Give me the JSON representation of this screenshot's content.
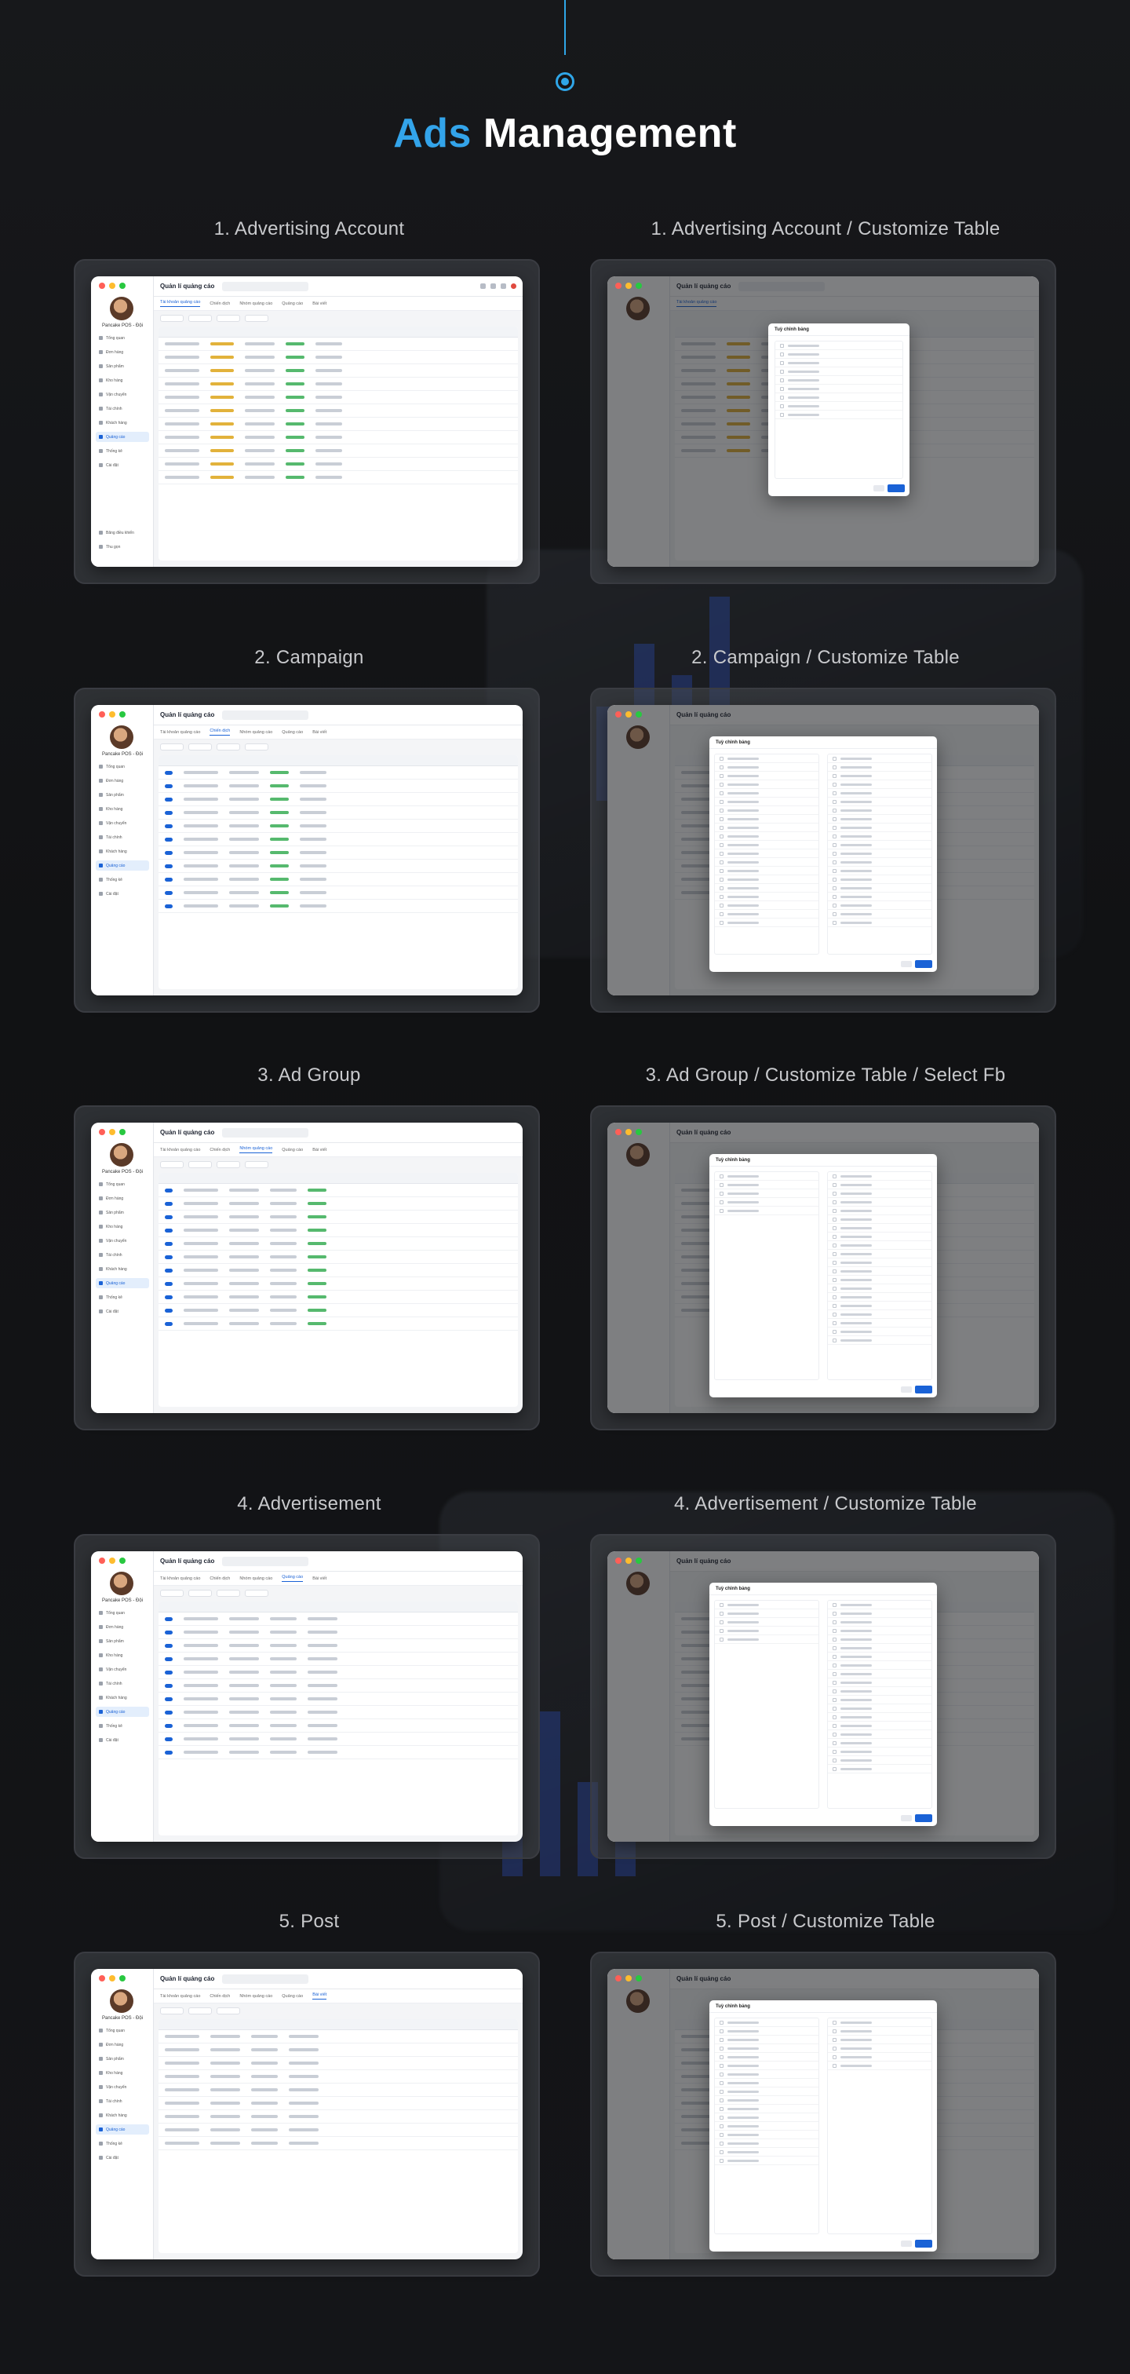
{
  "page": {
    "title_accent": "Ads",
    "title_rest": " Management"
  },
  "screens": {
    "s1": {
      "label": "1. Advertising Account",
      "window_title": "Quản lí quảng cáo"
    },
    "s2": {
      "label": "1. Advertising Account / Customize Table",
      "window_title": "Quản lí quảng cáo",
      "modal_title": "Tuỳ chỉnh bảng"
    },
    "s3": {
      "label": "2. Campaign",
      "window_title": "Quản lí quảng cáo"
    },
    "s4": {
      "label": "2. Campaign / Customize Table",
      "window_title": "Quản lí quảng cáo",
      "modal_title": "Tuỳ chỉnh bảng"
    },
    "s5": {
      "label": "3. Ad Group",
      "window_title": "Quản lí quảng cáo"
    },
    "s6": {
      "label": "3. Ad Group / Customize Table / Select Fb",
      "window_title": "Quản lí quảng cáo",
      "modal_title": "Tuỳ chỉnh bảng"
    },
    "s7": {
      "label": "4. Advertisement",
      "window_title": "Quản lí quảng cáo"
    },
    "s8": {
      "label": "4. Advertisement / Customize Table",
      "window_title": "Quản lí quảng cáo",
      "modal_title": "Tuỳ chỉnh bảng"
    },
    "s9": {
      "label": "5. Post",
      "window_title": "Quản lí quảng cáo"
    },
    "s10": {
      "label": "5. Post / Customize Table",
      "window_title": "Quản lí quảng cáo",
      "modal_title": "Tuỳ chỉnh bảng"
    }
  },
  "sidebar": {
    "user": "Pancake POS - Đội",
    "items": [
      "Tổng quan",
      "Đơn hàng",
      "Sản phẩm",
      "Kho hàng",
      "Vận chuyển",
      "Tài chính",
      "Khách hàng",
      "Quảng cáo",
      "Thống kê",
      "Cài đặt"
    ],
    "bottom": [
      "Băng điều khiển",
      "Thu gọn"
    ]
  },
  "tabs": [
    "Tài khoản quảng cáo",
    "Chiến dịch",
    "Nhóm quảng cáo",
    "Quảng cáo",
    "Bài viết"
  ],
  "colors": {
    "accent": "#33a4ea",
    "primary": "#1a62d6"
  }
}
